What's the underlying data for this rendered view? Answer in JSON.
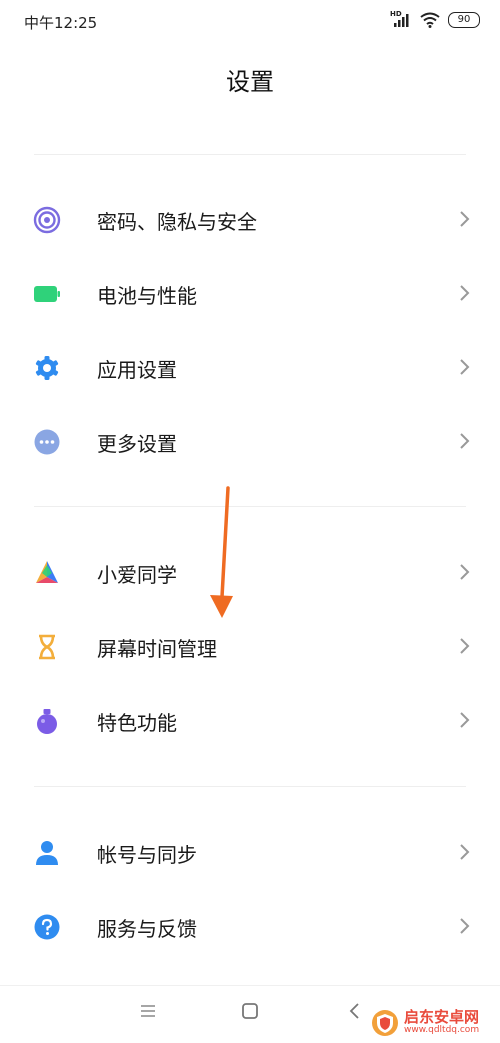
{
  "status": {
    "time": "中午12:25",
    "signal_label": "HD",
    "battery": "90"
  },
  "page": {
    "title": "设置"
  },
  "groups": [
    {
      "items": [
        {
          "label": "密码、隐私与安全",
          "icon": "fingerprint-icon",
          "color": "#7b6ce0"
        },
        {
          "label": "电池与性能",
          "icon": "battery-icon",
          "color": "#2fd27a"
        },
        {
          "label": "应用设置",
          "icon": "gear-icon",
          "color": "#2f8cf0"
        },
        {
          "label": "更多设置",
          "icon": "more-icon",
          "color": "#8aa6e3"
        }
      ]
    },
    {
      "items": [
        {
          "label": "小爱同学",
          "icon": "xiaoai-icon",
          "color": "#3c7cf5"
        },
        {
          "label": "屏幕时间管理",
          "icon": "hourglass-icon",
          "color": "#f3ae3b"
        },
        {
          "label": "特色功能",
          "icon": "flask-icon",
          "color": "#7b5ce6"
        }
      ]
    },
    {
      "items": [
        {
          "label": "帐号与同步",
          "icon": "person-icon",
          "color": "#2f8cf0"
        },
        {
          "label": "服务与反馈",
          "icon": "help-icon",
          "color": "#2f8cf0"
        }
      ]
    }
  ],
  "annotation": {
    "color": "#ef6b22"
  },
  "navbar": {
    "menu": "menu-icon",
    "home": "home-icon",
    "back": "back-icon"
  },
  "watermark": {
    "title": "启东安卓网",
    "url": "www.qdltdq.com",
    "color": "#e94b3c"
  }
}
